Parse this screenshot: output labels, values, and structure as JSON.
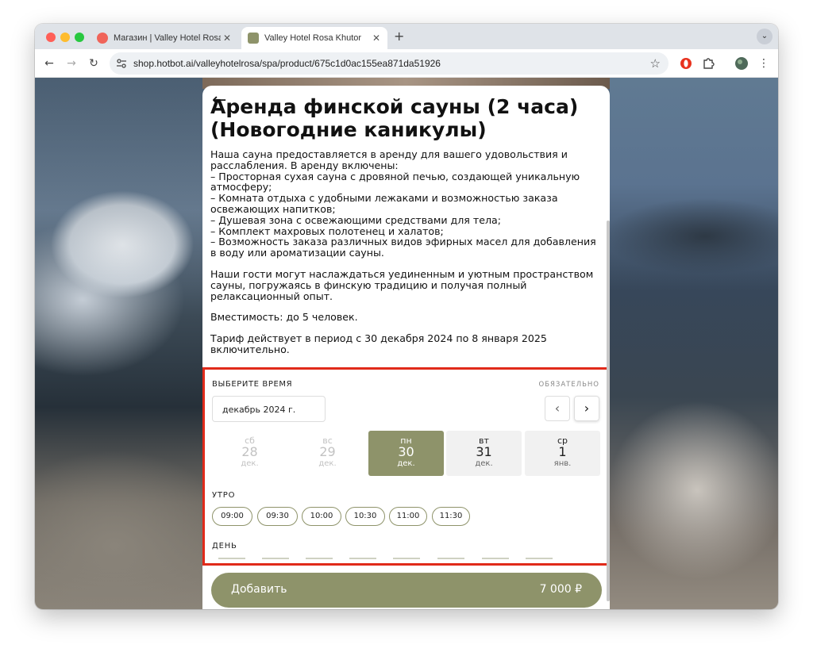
{
  "browser": {
    "tabs": [
      {
        "title": "Магазин | Valley Hotel Rosa Khutor",
        "active": false,
        "favicon": "hotbot-icon"
      },
      {
        "title": "Valley Hotel Rosa Khutor",
        "active": true,
        "favicon": "hotel-icon"
      }
    ],
    "close_glyph": "✕",
    "new_tab_glyph": "+",
    "tab_menu_glyph": "⌄",
    "url": "shop.hotbot.ai/valleyhotelrosa/spa/product/675c1d0ac155ea871da51926",
    "nav": {
      "back": "←",
      "forward": "→",
      "reload": "↻",
      "star": "☆",
      "menu": "⋮"
    }
  },
  "product": {
    "back_glyph": "←",
    "title": "Аренда финской сауны (2 часа) (Новогодние каникулы)",
    "description": [
      "Наша сауна предоставляется в аренду для вашего удовольствия и расслабления. В аренду включены:",
      "– Просторная сухая сауна с дровяной печью, создающей уникальную атмосферу;",
      "– Комната отдыха с удобными лежаками и возможностью заказа освежающих напитков;",
      "– Душевая зона с освежающими средствами для тела;",
      "– Комплект махровых полотенец и халатов;",
      "– Возможность заказа различных видов эфирных масел для добавления в воду или ароматизации сауны."
    ],
    "paragraph2": "Наши гости могут наслаждаться уединенным и уютным пространством сауны, погружаясь в финскую традицию и получая полный релаксационный опыт.",
    "capacity": "Вместимость: до 5 человек.",
    "tariff": "Тариф действует в период с 30 декабря 2024 по 8 января 2025 включительно."
  },
  "booking": {
    "label": "ВЫБЕРИТЕ ВРЕМЯ",
    "required": "ОБЯЗАТЕЛЬНО",
    "month": "декабрь 2024 г.",
    "prev_glyph": "‹",
    "next_glyph": "›",
    "days": [
      {
        "dow": "сб",
        "num": "28",
        "mon": "дек.",
        "state": "disabled"
      },
      {
        "dow": "вс",
        "num": "29",
        "mon": "дек.",
        "state": "disabled"
      },
      {
        "dow": "пн",
        "num": "30",
        "mon": "дек.",
        "state": "selected"
      },
      {
        "dow": "вт",
        "num": "31",
        "mon": "дек.",
        "state": "available"
      },
      {
        "dow": "ср",
        "num": "1",
        "mon": "янв.",
        "state": "available"
      }
    ],
    "morning_label": "УТРО",
    "morning_slots": [
      "09:00",
      "09:30",
      "10:00",
      "10:30",
      "11:00",
      "11:30"
    ],
    "day_label": "ДЕНЬ"
  },
  "cart": {
    "add_label": "Добавить",
    "price": "7 000 ₽"
  },
  "colors": {
    "accent": "#8e936a",
    "highlight_border": "#e02a1a"
  }
}
